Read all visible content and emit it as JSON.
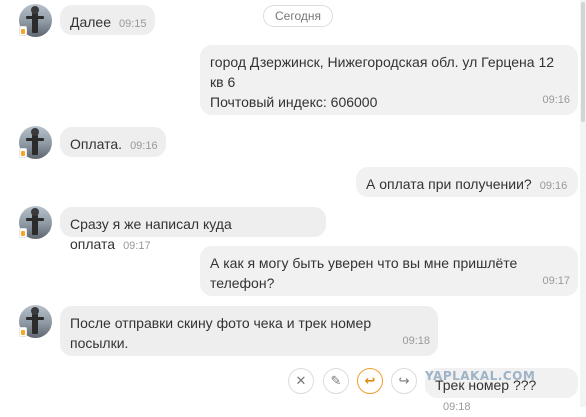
{
  "chat": {
    "date_separator": "Сегодня",
    "messages": [
      {
        "side": "in",
        "text": "Далее",
        "time": "09:15"
      },
      {
        "side": "out",
        "text": "город Дзержинск, Нижегородская обл. ул Герцена 12\nкв 6\nПочтовый индекс: 606000",
        "time": "09:16"
      },
      {
        "side": "in",
        "text": "Оплата.",
        "time": "09:16"
      },
      {
        "side": "out",
        "text": "А оплата при получении?",
        "time": "09:16"
      },
      {
        "side": "in",
        "text": "Сразу я же написал куда оплата",
        "time": "09:17"
      },
      {
        "side": "out",
        "text": "А как я могу быть уверен что вы мне пришлёте\nтелефон?",
        "time": "09:17"
      },
      {
        "side": "in",
        "text": "После отправки скину фото чека и трек номер\nпосылки.",
        "time": "09:18"
      },
      {
        "side": "out",
        "text": "Трек номер ???",
        "time": "09:18"
      }
    ]
  },
  "message_actions": [
    {
      "name": "delete",
      "icon": "close-icon",
      "glyph": "✕"
    },
    {
      "name": "edit",
      "icon": "pencil-icon",
      "glyph": "✎"
    },
    {
      "name": "reply",
      "icon": "reply-icon",
      "glyph": "↩"
    },
    {
      "name": "forward",
      "icon": "forward-icon",
      "glyph": "↪"
    }
  ],
  "watermark": "YAPLAKAL.COM",
  "colors": {
    "incoming_bubble": "#eeeeee",
    "outgoing_bubble": "#f1f1f1",
    "reply_accent": "#f0a030",
    "status_dot": "#f5a623"
  }
}
